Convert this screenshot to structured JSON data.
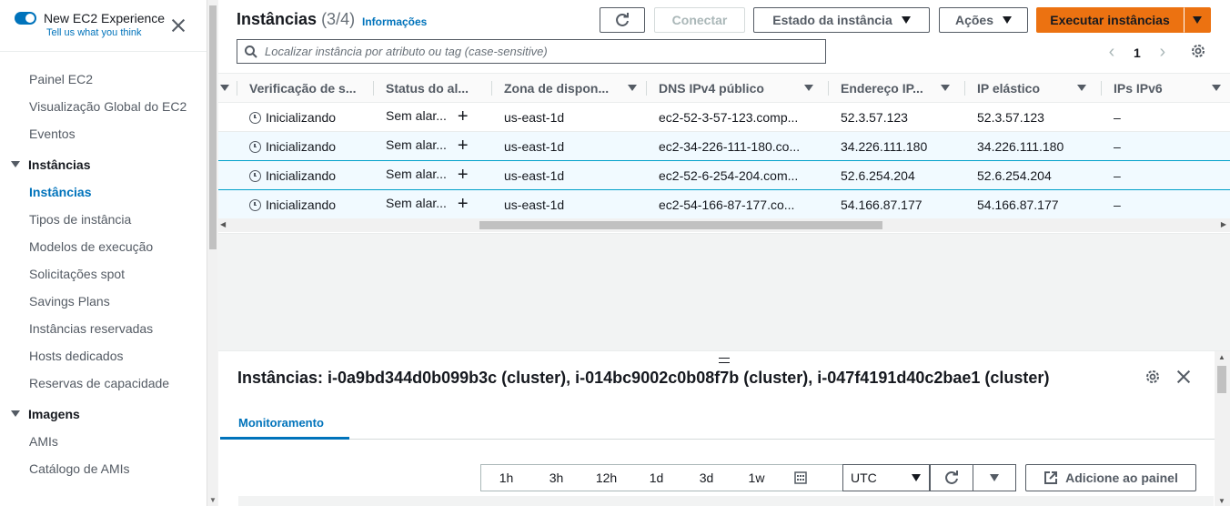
{
  "sidebar": {
    "toggle_title": "New EC2 Experience",
    "toggle_sub": "Tell us what you think",
    "items_top": [
      "Painel EC2",
      "Visualização Global do EC2",
      "Eventos"
    ],
    "section_instances": "Instâncias",
    "items_instances": [
      "Instâncias",
      "Tipos de instância",
      "Modelos de execução",
      "Solicitações spot",
      "Savings Plans",
      "Instâncias reservadas",
      "Hosts dedicados",
      "Reservas de capacidade"
    ],
    "section_images": "Imagens",
    "items_images": [
      "AMIs",
      "Catálogo de AMIs"
    ]
  },
  "header": {
    "title": "Instâncias",
    "count": "(3/4)",
    "info_link": "Informações",
    "connect": "Conectar",
    "instance_state": "Estado da instância",
    "actions": "Ações",
    "launch": "Executar instâncias",
    "search_placeholder": "Localizar instância por atributo ou tag (case-sensitive)",
    "page": "1"
  },
  "table": {
    "columns": [
      "Verificação de s...",
      "Status do al...",
      "Zona de dispon...",
      "DNS IPv4 público",
      "Endereço IP...",
      "IP elástico",
      "IPs IPv6"
    ],
    "rows": [
      {
        "check": "Inicializando",
        "alarm": "Sem alar...",
        "zone": "us-east-1d",
        "dns": "ec2-52-3-57-123.comp...",
        "ip": "52.3.57.123",
        "eip": "52.3.57.123",
        "ipv6": "–",
        "selected": false
      },
      {
        "check": "Inicializando",
        "alarm": "Sem alar...",
        "zone": "us-east-1d",
        "dns": "ec2-34-226-111-180.co...",
        "ip": "34.226.111.180",
        "eip": "34.226.111.180",
        "ipv6": "–",
        "selected": true
      },
      {
        "check": "Inicializando",
        "alarm": "Sem alar...",
        "zone": "us-east-1d",
        "dns": "ec2-52-6-254-204.com...",
        "ip": "52.6.254.204",
        "eip": "52.6.254.204",
        "ipv6": "–",
        "selected": true
      },
      {
        "check": "Inicializando",
        "alarm": "Sem alar...",
        "zone": "us-east-1d",
        "dns": "ec2-54-166-87-177.co...",
        "ip": "54.166.87.177",
        "eip": "54.166.87.177",
        "ipv6": "–",
        "selected": true
      }
    ]
  },
  "detail": {
    "title": "Instâncias: i-0a9bd344d0b099b3c (cluster), i-014bc9002c0b08f7b (cluster), i-047f4191d40c2bae1 (cluster)",
    "tab": "Monitoramento",
    "ranges": [
      "1h",
      "3h",
      "12h",
      "1d",
      "3d",
      "1w"
    ],
    "timezone": "UTC",
    "add_dashboard": "Adicione ao painel"
  },
  "colors": {
    "accent": "#0073bb",
    "primary": "#ec7211"
  },
  "icons": [
    "close-icon",
    "refresh-icon",
    "search-icon",
    "gear-icon",
    "clock-icon",
    "plus-icon",
    "calendar-icon",
    "external-link-icon"
  ]
}
